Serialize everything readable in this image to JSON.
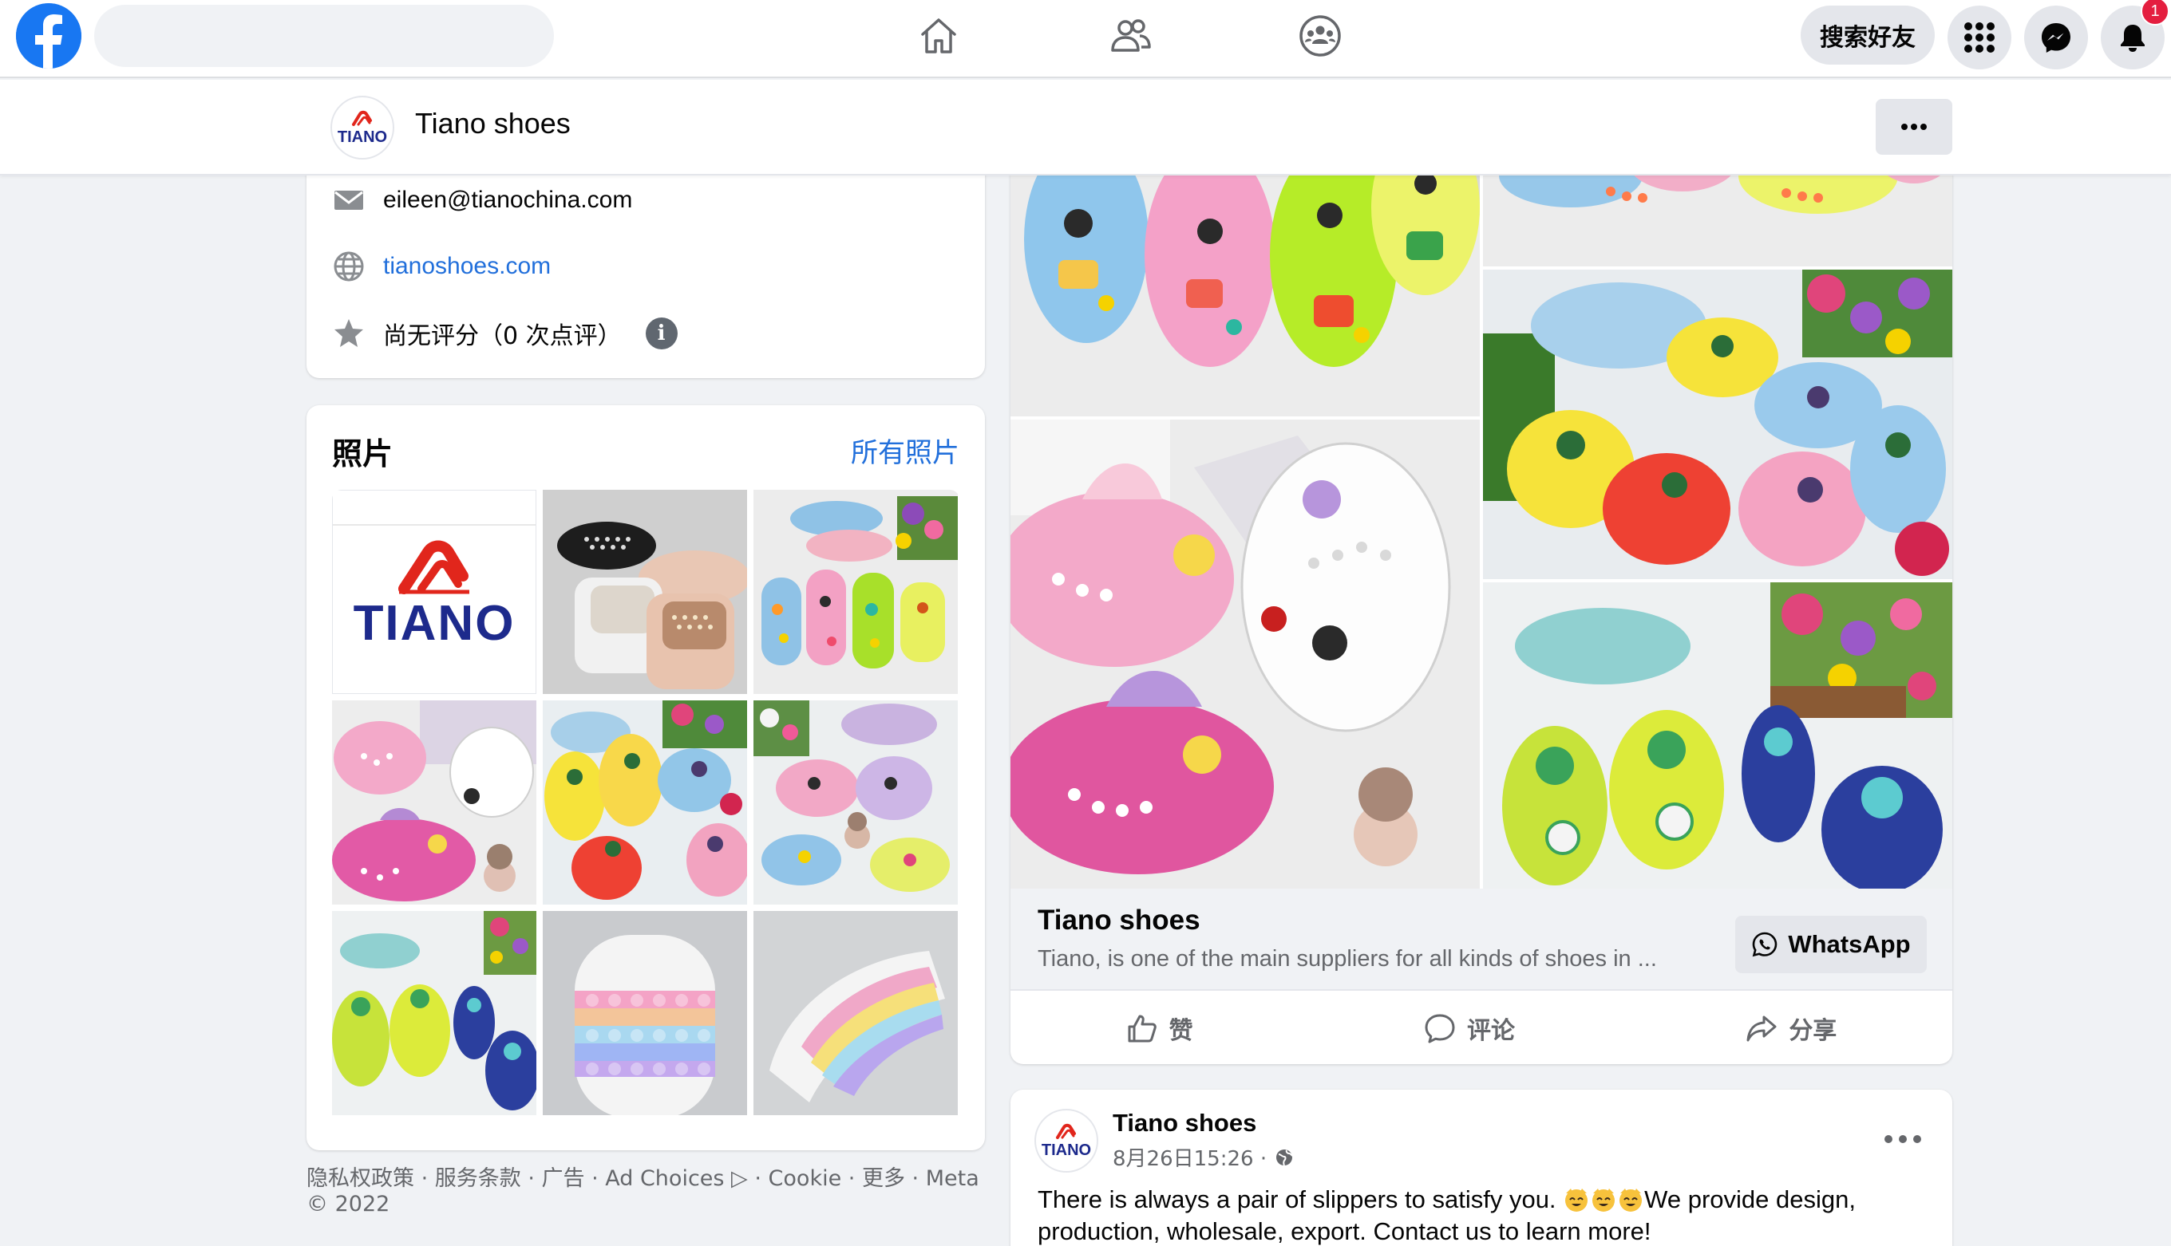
{
  "colors": {
    "brand_blue": "#1877f2",
    "link_blue": "#216fdb",
    "page_bg": "#f0f2f5",
    "secondary_text": "#65676b",
    "badge_red": "#e41e3f",
    "tiano_red": "#e1261c",
    "tiano_navy": "#1d2a8c"
  },
  "topnav": {
    "logo_icon": "facebook-logo-icon",
    "search_placeholder": "",
    "tabs": [
      {
        "icon": "home-icon"
      },
      {
        "icon": "friends-icon"
      },
      {
        "icon": "groups-icon"
      }
    ],
    "find_friends_label": "搜索好友",
    "menu_icon": "grid-menu-icon",
    "messenger_icon": "messenger-icon",
    "notifications_icon": "bell-icon",
    "notification_count": "1"
  },
  "page_header": {
    "avatar_text": "TIANO",
    "title": "Tiano shoes",
    "more_icon": "ellipsis-icon"
  },
  "intro": {
    "email": "eileen@tianochina.com",
    "website": "tianoshoes.com",
    "rating": "尚无评分（0 次点评）",
    "icons": [
      "mail-icon",
      "globe-icon",
      "star-icon",
      "info-icon"
    ]
  },
  "photos": {
    "title": "照片",
    "see_all": "所有照片",
    "logo_word": "TIANO"
  },
  "footer": {
    "links": "隐私权政策 · 服务条款 · 广告 · Ad Choices ▷ · Cookie · 更多 · Meta © 2022"
  },
  "post": {
    "link_title": "Tiano shoes",
    "link_description": "Tiano, is one of the main suppliers for all kinds of shoes in ...",
    "whatsapp_label": "WhatsApp",
    "actions": {
      "like": "赞",
      "comment": "评论",
      "share": "分享"
    }
  },
  "post2": {
    "author": "Tiano shoes",
    "avatar_text": "TIANO",
    "timestamp": "8月26日15:26 ·",
    "text_before_emoji": "There is always a pair of slippers to satisfy you. ",
    "text_after_emoji": "We provide design, production, wholesale, export. Contact us to learn more!"
  }
}
